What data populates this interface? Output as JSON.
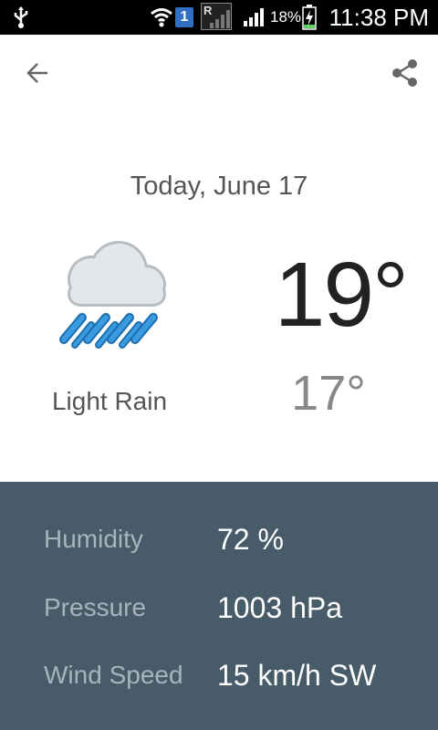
{
  "status_bar": {
    "sim_slot": "1",
    "roaming_indicator": "R",
    "battery_percent": "18%",
    "time": "11:38 PM"
  },
  "app_bar": {
    "back_icon": "arrow-left-icon",
    "share_icon": "share-icon"
  },
  "forecast": {
    "date": "Today, June 17",
    "condition": "Light Rain",
    "condition_icon": "light-rain-icon",
    "high": "19°",
    "low": "17°"
  },
  "details": {
    "rows": [
      {
        "label": "Humidity",
        "value": "72 %"
      },
      {
        "label": "Pressure",
        "value": "1003 hPa"
      },
      {
        "label": "Wind Speed",
        "value": "15 km/h SW"
      }
    ]
  },
  "colors": {
    "details_background": "#475b68",
    "rain_blue": "#2f8fd6"
  }
}
